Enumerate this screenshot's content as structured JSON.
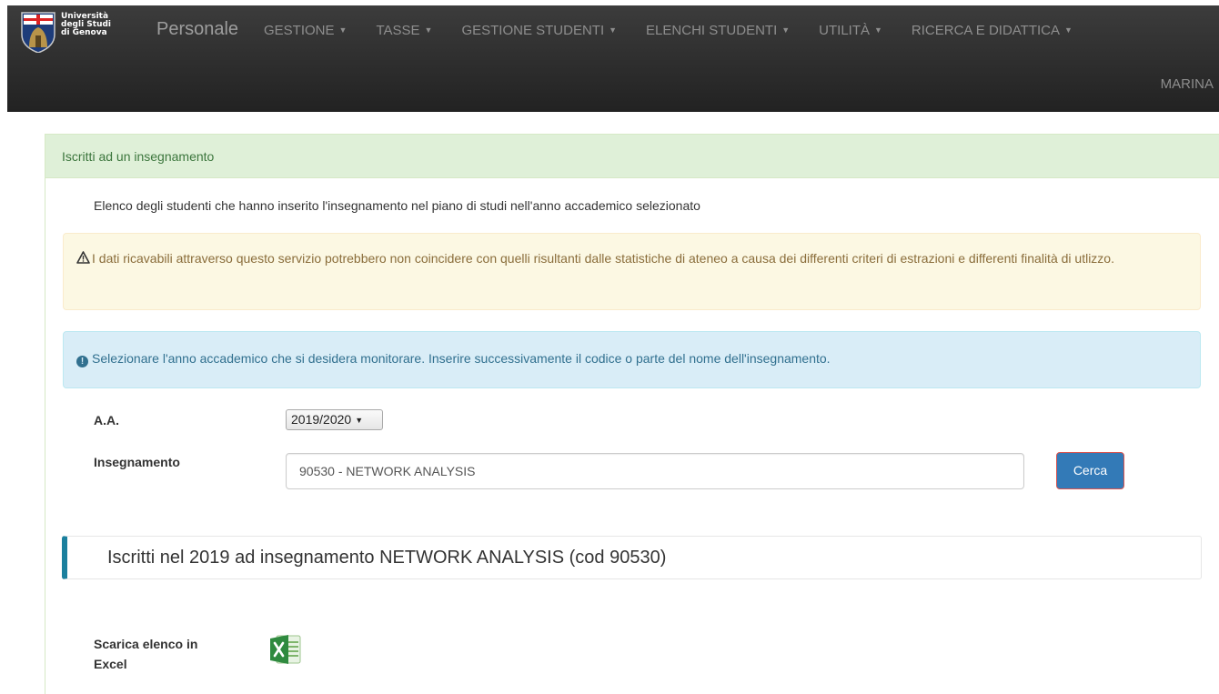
{
  "header": {
    "logo_lines": [
      "Università",
      "degli Studi",
      "di Genova"
    ],
    "brand": "Personale",
    "nav": [
      {
        "label": "GESTIONE"
      },
      {
        "label": "TASSE"
      },
      {
        "label": "GESTIONE STUDENTI"
      },
      {
        "label": "ELENCHI STUDENTI"
      },
      {
        "label": "UTILITÀ"
      },
      {
        "label": "RICERCA E DIDATTICA"
      }
    ],
    "user": "MARINA"
  },
  "panel": {
    "title": "Iscritti ad un insegnamento",
    "intro": "Elenco degli studenti che hanno inserito l'insegnamento nel piano di studi nell'anno accademico selezionato",
    "warning": "I dati ricavabili attraverso questo servizio potrebbero non coincidere con quelli risultanti dalle statistiche di ateneo a causa dei differenti criteri di estrazioni e differenti finalità di utlizzo.",
    "info": "Selezionare l'anno accademico che si desidera monitorare. Inserire successivamente il codice o parte del nome dell'insegnamento."
  },
  "form": {
    "aa_label": "A.A.",
    "aa_value": "2019/2020",
    "insegnamento_label": "Insegnamento",
    "insegnamento_value": "90530 - NETWORK ANALYSIS",
    "search_label": "Cerca"
  },
  "results": {
    "heading": "Iscritti nel 2019 ad insegnamento NETWORK ANALYSIS (cod 90530)",
    "download_label": "Scarica elenco in Excel"
  },
  "colors": {
    "navbar": "#222222",
    "panel_heading_bg": "#dff0d8",
    "warning_bg": "#fcf8e3",
    "info_bg": "#d9edf7",
    "primary": "#337ab7",
    "section_accent": "#1b809e"
  },
  "icons": [
    "university-crest-icon",
    "warning-icon",
    "info-icon",
    "excel-icon"
  ]
}
